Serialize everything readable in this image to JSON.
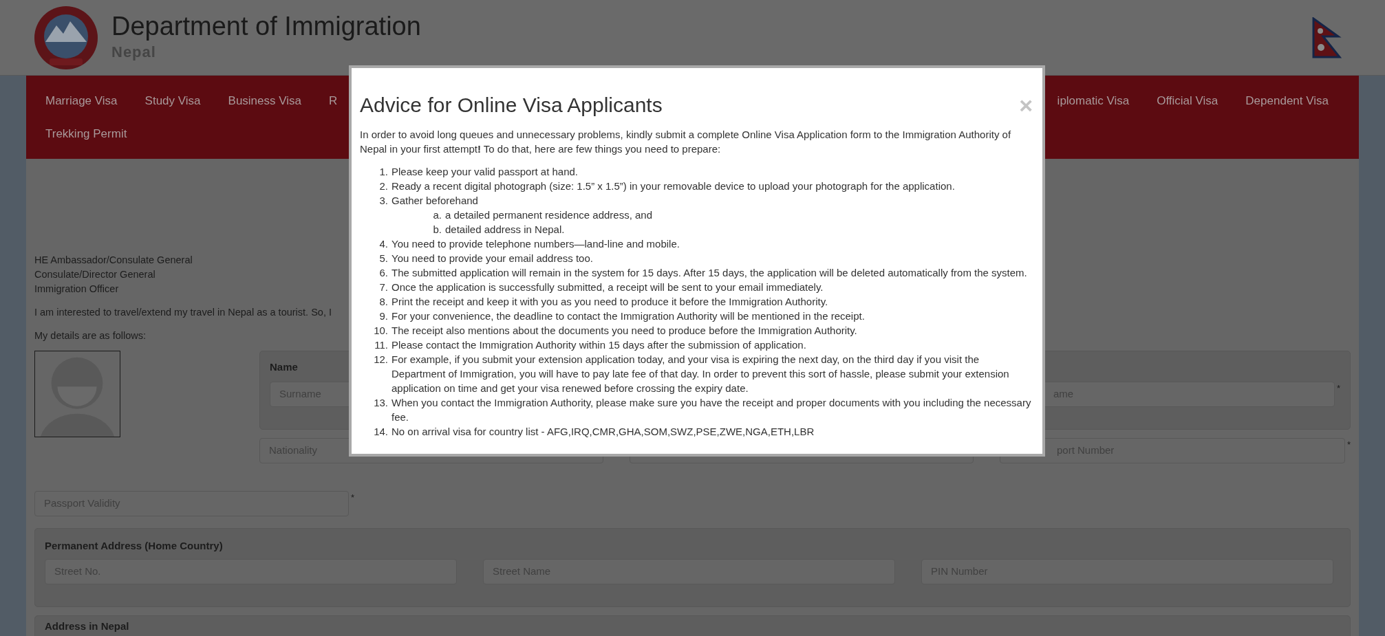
{
  "header": {
    "title": "Department of Immigration",
    "subtitle": "Nepal"
  },
  "nav": {
    "left_items": [
      {
        "label": "Marriage Visa"
      },
      {
        "label": "Study Visa"
      },
      {
        "label": "Business Visa"
      },
      {
        "label": "R"
      }
    ],
    "right_items": [
      {
        "label": "iplomatic Visa"
      },
      {
        "label": "Official Visa"
      },
      {
        "label": "Dependent Visa"
      }
    ],
    "second_row": [
      {
        "label": "Trekking Permit"
      }
    ]
  },
  "letter": {
    "addressees": [
      "HE Ambassador/Consulate General",
      "Consulate/Director General",
      "Immigration Officer"
    ],
    "intro": "I am interested to travel/extend my travel in Nepal as a tourist. So, I",
    "details_line": "My details are as follows:"
  },
  "name_panel": {
    "title": "Name",
    "fields": [
      {
        "placeholder": "Surname"
      },
      {
        "placeholder": "ame",
        "required_mark": "*"
      }
    ]
  },
  "second_row_fields": [
    {
      "placeholder": "Nationality"
    },
    {
      "placeholder": "port Number",
      "required_mark": "*"
    }
  ],
  "passport_validity": {
    "placeholder": "Passport Validity",
    "required_mark": "*"
  },
  "permanent_address": {
    "title": "Permanent Address (Home Country)",
    "fields": [
      {
        "placeholder": "Street No."
      },
      {
        "placeholder": "Street Name"
      },
      {
        "placeholder": "PIN Number"
      }
    ]
  },
  "nepal_address": {
    "title": "Address in Nepal"
  },
  "modal": {
    "title": "Advice for Online Visa Applicants",
    "close": "×",
    "intro": "In order to avoid long queues and unnecessary problems, kindly submit a complete Online Visa Application form to the Immigration Authority of Nepal in your first attempt**!** To do that, here are few things you need to prepare:",
    "items": [
      {
        "number": "1.",
        "text": "Please keep your valid passport at hand."
      },
      {
        "number": "2.",
        "text": "Ready a recent digital photograph (size: 1.5” x 1.5”) in your removable device to upload your photograph for the application."
      },
      {
        "number": "3.",
        "text": "Gather beforehand",
        "children": [
          {
            "number": "a.",
            "text": "a detailed permanent residence address, and"
          },
          {
            "number": "b.",
            "text": "detailed address in Nepal."
          }
        ]
      },
      {
        "number": "4.",
        "text": "You need to provide telephone numbers—land-line and mobile."
      },
      {
        "number": "5.",
        "text": "You need to provide your email address too."
      },
      {
        "number": "6.",
        "text": "The submitted application will remain in the system for 15 days. After 15 days, the application will be deleted automatically from the system."
      },
      {
        "number": "7.",
        "text": "Once the application is successfully submitted, a receipt will be sent to your email immediately."
      },
      {
        "number": "8.",
        "text": "Print the receipt and keep it with you as you need to produce it before the Immigration Authority."
      },
      {
        "number": "9.",
        "text": "For your convenience, the deadline to contact the Immigration Authority will be mentioned in the receipt."
      },
      {
        "number": "10.",
        "text": "The receipt also mentions about the documents you need to produce before the Immigration Authority."
      },
      {
        "number": "11.",
        "text": "Please contact the Immigration Authority within 15 days after the submission of application."
      },
      {
        "number": "12.",
        "text": "For example, if you submit your extension application today, and your visa is expiring the next day, on the third day if you visit the Department of Immigration, you will have to pay late fee of that day. In order to prevent this sort of hassle, please submit your extension application on time and get your visa renewed before crossing the expiry date."
      },
      {
        "number": "13.",
        "text": "When you contact the Immigration Authority, please make sure you have the receipt and proper documents with you including the necessary fee."
      },
      {
        "number": "14.",
        "text": "No on arrival visa for country list - AFG,IRQ,CMR,GHA,SOM,SWZ,PSE,ZWE,NGA,ETH,LBR"
      }
    ]
  }
}
